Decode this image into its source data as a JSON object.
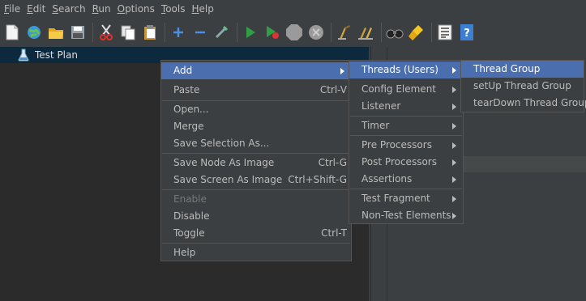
{
  "menubar": {
    "items": [
      {
        "label": "File",
        "mnemonic": "F",
        "rest": "ile"
      },
      {
        "label": "Edit",
        "mnemonic": "E",
        "rest": "dit"
      },
      {
        "label": "Search",
        "mnemonic": "S",
        "rest": "earch"
      },
      {
        "label": "Run",
        "mnemonic": "R",
        "rest": "un"
      },
      {
        "label": "Options",
        "mnemonic": "O",
        "rest": "ptions"
      },
      {
        "label": "Tools",
        "mnemonic": "T",
        "rest": "ools"
      },
      {
        "label": "Help",
        "mnemonic": "H",
        "rest": "elp"
      }
    ]
  },
  "toolbar": {
    "icons": [
      "new-icon",
      "templates-icon",
      "open-icon",
      "save-icon",
      "cut-icon",
      "copy-icon",
      "paste-icon",
      "expand-icon",
      "collapse-icon",
      "toggle-icon",
      "start-icon",
      "start-no-pauses-icon",
      "stop-icon",
      "shutdown-icon",
      "clear-icon",
      "clear-all-icon",
      "search-icon",
      "reset-search-icon",
      "function-helper-icon",
      "help-icon"
    ]
  },
  "tree": {
    "root_label": "Test Plan",
    "root_icon": "flask-icon"
  },
  "context_menu": {
    "items": [
      {
        "label": "Add",
        "submenu": true,
        "highlighted": true
      },
      {
        "label": "Paste",
        "shortcut": "Ctrl-V"
      },
      {
        "label": "Open..."
      },
      {
        "label": "Merge"
      },
      {
        "label": "Save Selection As..."
      },
      {
        "label": "Save Node As Image",
        "shortcut": "Ctrl-G"
      },
      {
        "label": "Save Screen As Image",
        "shortcut": "Ctrl+Shift-G"
      },
      {
        "label": "Enable",
        "disabled": true
      },
      {
        "label": "Disable"
      },
      {
        "label": "Toggle",
        "shortcut": "Ctrl-T"
      },
      {
        "label": "Help"
      }
    ]
  },
  "add_submenu": {
    "items": [
      {
        "label": "Threads (Users)",
        "highlighted": true
      },
      {
        "label": "Config Element"
      },
      {
        "label": "Listener"
      },
      {
        "label": "Timer"
      },
      {
        "label": "Pre Processors"
      },
      {
        "label": "Post Processors"
      },
      {
        "label": "Assertions"
      },
      {
        "label": "Test Fragment"
      },
      {
        "label": "Non-Test Elements"
      }
    ]
  },
  "threads_submenu": {
    "items": [
      {
        "label": "Thread Group",
        "highlighted": true
      },
      {
        "label": "setUp Thread Group"
      },
      {
        "label": "tearDown Thread Group"
      }
    ]
  },
  "colors": {
    "background": "#3c3f41",
    "tree_background": "#2b2b2b",
    "selection": "#4b6eaf",
    "text": "#bbbbbb"
  }
}
